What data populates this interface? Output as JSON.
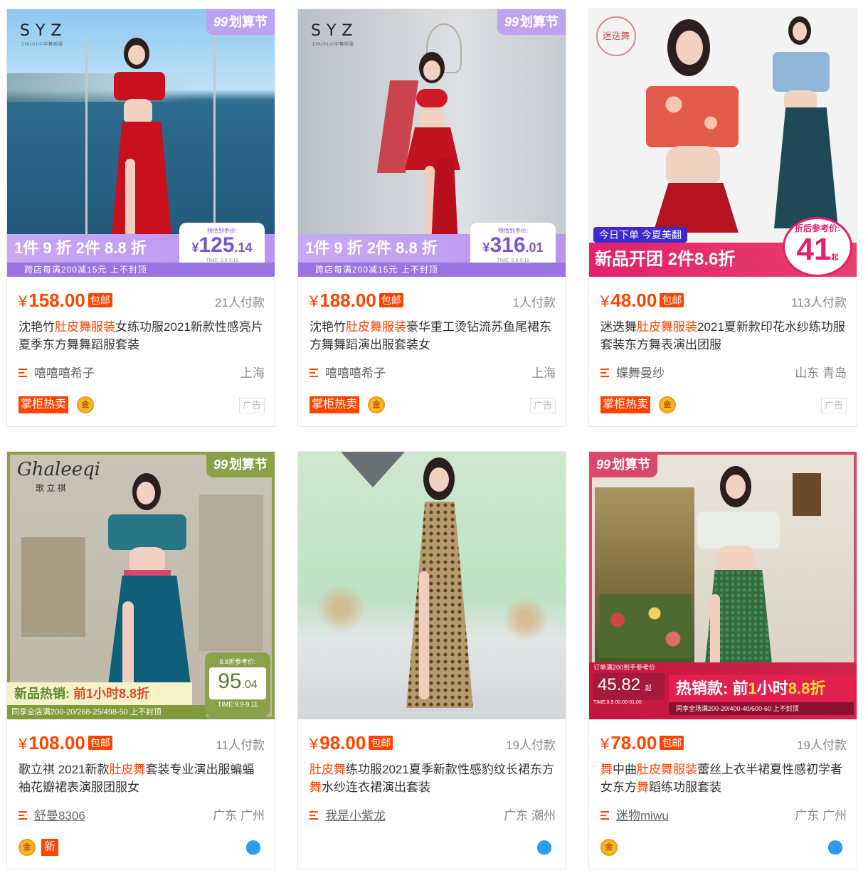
{
  "products": [
    {
      "price": "158.00",
      "shipping": "包邮",
      "sales": "21人付款",
      "title_segments": [
        {
          "text": "沈艳竹",
          "hl": false
        },
        {
          "text": "肚皮舞服装",
          "hl": true
        },
        {
          "text": "女练功服2021新款性感亮片夏季东方舞舞蹈服套装",
          "hl": false
        }
      ],
      "shop": "嘻嘻嘻希子",
      "location": "上海",
      "hot_badge": "掌柜热卖",
      "ad_label": "广告",
      "image": {
        "brand": "SYZ",
        "brand_sub": "ZHU01小宇舞蹈服",
        "festival": "划算节",
        "festival_num": "99",
        "promo_deal": "1件 9 折 2件 8.8 折",
        "promo_sub": "跨店每满200减15元 上不封顶",
        "promo_price_label": "预估到手价:",
        "promo_price_int": "125",
        "promo_price_dec": ".14",
        "promo_time": "TIME: 9.9-9.11",
        "promo_yen": "¥"
      }
    },
    {
      "price": "188.00",
      "shipping": "包邮",
      "sales": "1人付款",
      "title_segments": [
        {
          "text": "沈艳竹",
          "hl": false
        },
        {
          "text": "肚皮舞服装",
          "hl": true
        },
        {
          "text": "豪华重工烫钻流苏鱼尾裙东方舞舞蹈演出服套装女",
          "hl": false
        }
      ],
      "shop": "嘻嘻嘻希子",
      "location": "上海",
      "hot_badge": "掌柜热卖",
      "ad_label": "广告",
      "image": {
        "brand": "SYZ",
        "brand_sub": "ZHU01小宇舞蹈服",
        "festival": "划算节",
        "festival_num": "99",
        "promo_deal": "1件 9 折 2件 8.8 折",
        "promo_sub": "跨店每满200减15元 上不封顶",
        "promo_price_label": "预估到手价:",
        "promo_price_int": "316",
        "promo_price_dec": ".01",
        "promo_time": "TIME: 9.9-9.11",
        "promo_yen": "¥"
      }
    },
    {
      "price": "48.00",
      "shipping": "包邮",
      "sales": "113人付款",
      "title_segments": [
        {
          "text": "迷迭舞",
          "hl": false
        },
        {
          "text": "肚皮舞服装",
          "hl": true
        },
        {
          "text": "2021夏新款印花水纱练功服套装东方舞表演出团服",
          "hl": false
        }
      ],
      "shop": "蝶舞曼纱",
      "location": "山东 青岛",
      "hot_badge": "掌柜热卖",
      "ad_label": "广告",
      "image": {
        "brand": "迷迭舞",
        "promo_tag": "今日下单 今夏美翻",
        "promo_band": "新品开团 2件8.6折",
        "promo_price_label": "折后参考价:",
        "promo_price": "41",
        "promo_unit": "起"
      }
    },
    {
      "price": "108.00",
      "shipping": "包邮",
      "sales": "11人付款",
      "title_segments": [
        {
          "text": "歌立祺 2021新款",
          "hl": false
        },
        {
          "text": "肚皮舞",
          "hl": true
        },
        {
          "text": "套装专业演出服蝙蝠袖花瓣裙表演服团服女",
          "hl": false
        }
      ],
      "shop": "舒曼8306",
      "location": "广东 广州",
      "image": {
        "brand": "Ghaleeqi",
        "brand_sub": "歌 立 祺",
        "festival": "划算节",
        "festival_num": "99",
        "promo_band_a": "新品热销:",
        "promo_band_b": "前1小时8.8折",
        "promo_sub": "同享全店满200-20/268-25/498-50 上不封顶",
        "promo_price_label": "8.8折参考价:",
        "promo_price_int": "95",
        "promo_price_dec": ".04",
        "promo_time": "TIME:9.9-9.11"
      },
      "new_badge": "新"
    },
    {
      "price": "98.00",
      "shipping": "包邮",
      "sales": "19人付款",
      "title_segments": [
        {
          "text": "肚皮舞",
          "hl": true
        },
        {
          "text": "练功服2021夏季新款性感豹纹长裙东方",
          "hl": false
        },
        {
          "text": "舞",
          "hl": true
        },
        {
          "text": "水纱连衣裙演出套装",
          "hl": false
        }
      ],
      "shop": "我是小紫龙",
      "location": "广东 潮州"
    },
    {
      "price": "78.00",
      "shipping": "包邮",
      "sales": "19人付款",
      "title_segments": [
        {
          "text": "舞",
          "hl": true
        },
        {
          "text": "中曲",
          "hl": false
        },
        {
          "text": "肚皮舞服装",
          "hl": true
        },
        {
          "text": "蕾丝上衣半裙夏性感初学者女东方",
          "hl": false
        },
        {
          "text": "舞",
          "hl": true
        },
        {
          "text": "蹈练功服套装",
          "hl": false
        }
      ],
      "shop": "迷物miwu",
      "location": "广东 广州",
      "image": {
        "festival": "划算节",
        "festival_num": "99",
        "promo_price_label": "订单满200到手参考价",
        "promo_price": "45.82",
        "promo_unit": "起",
        "promo_time": "TIME:9.9 00:00-01:00",
        "promo_band_a": "热销款: 前",
        "promo_band_b": "1",
        "promo_band_c": "小时",
        "promo_band_d": "8.8折",
        "promo_sub": "同享全场满200-20/400-40/600-60 上不封顶"
      }
    }
  ],
  "currency": "¥",
  "medal_glyph": "金",
  "colors": {
    "accent": "#ff4400",
    "syz_purple": "#b896ee",
    "mixiwu_pink": "#e3216c",
    "ghaleeqi_green": "#8aa14a",
    "miwu_red": "#e3204f"
  }
}
